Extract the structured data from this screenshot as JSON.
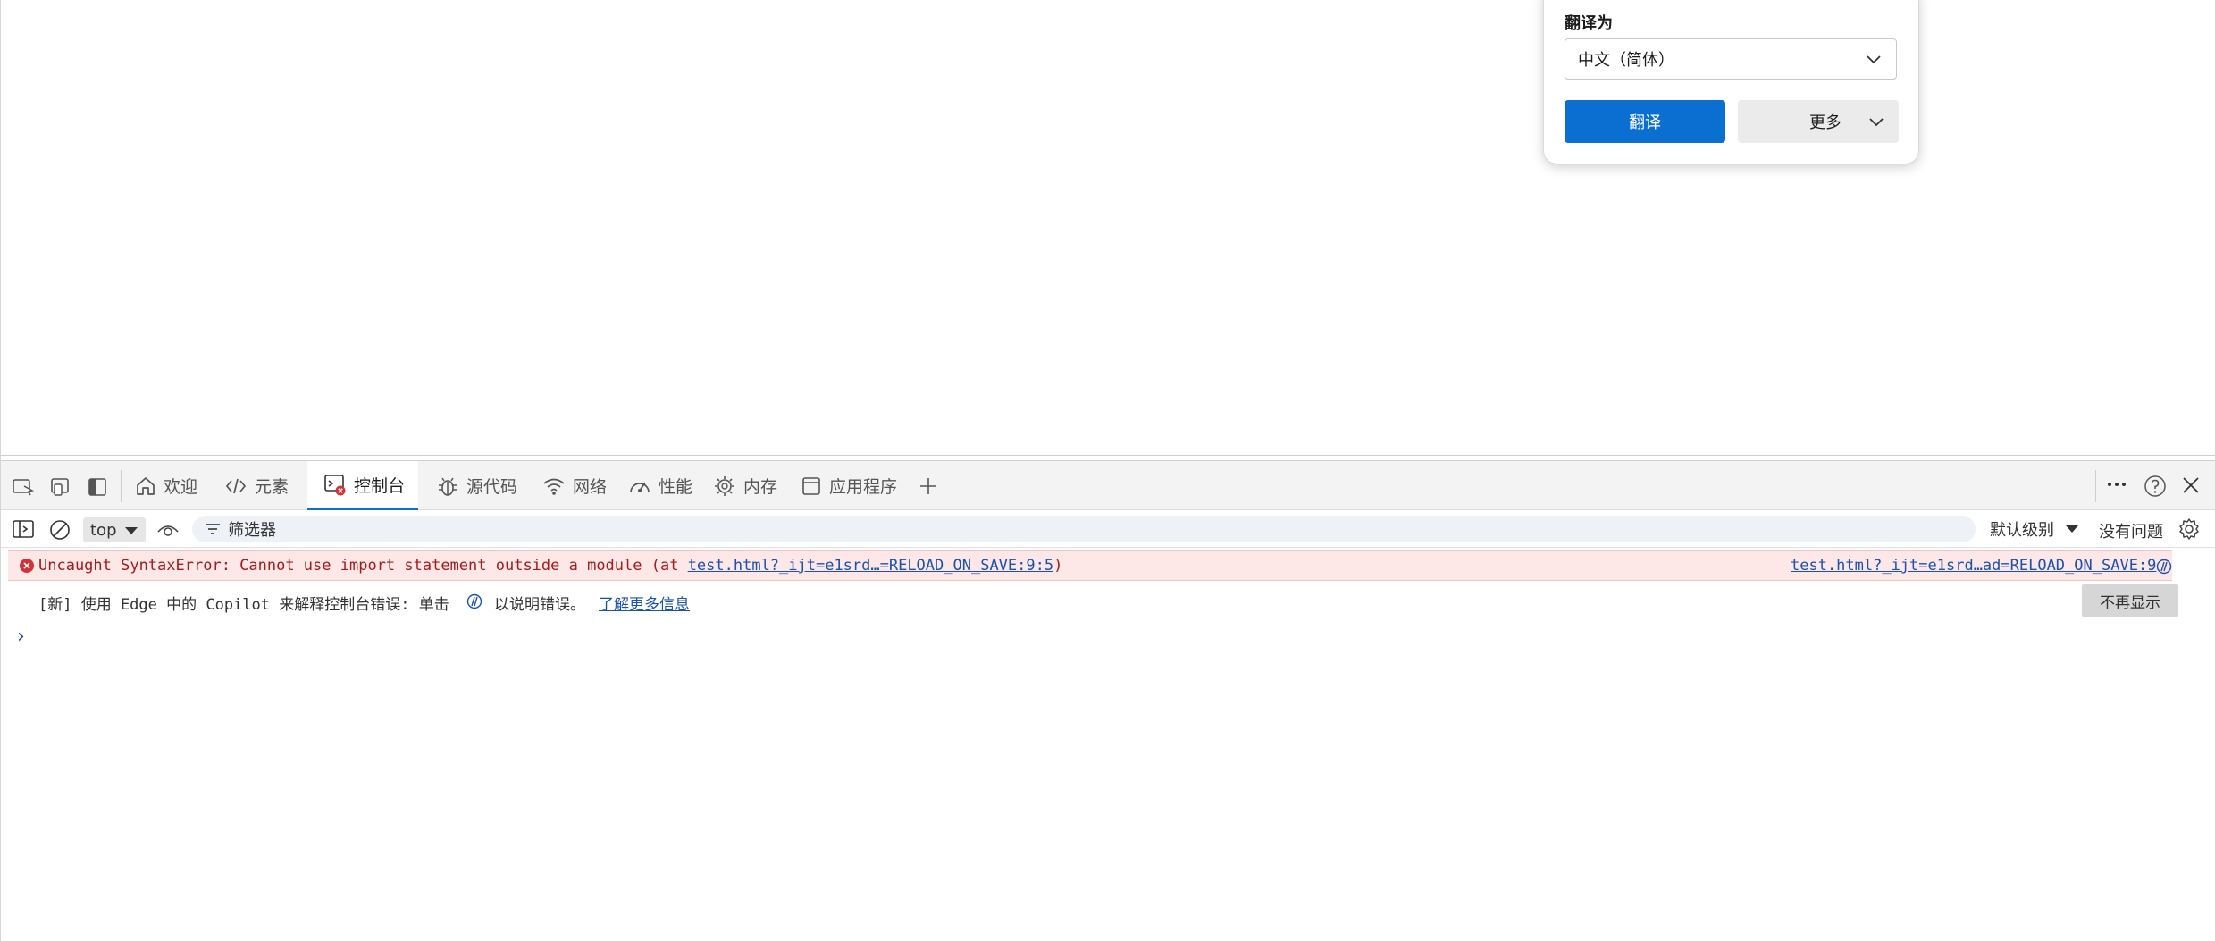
{
  "translate_popup": {
    "label": "翻译为",
    "language": "中文（简体）",
    "translate_button": "翻译",
    "more_button": "更多"
  },
  "devtools": {
    "tabs": [
      {
        "label": "欢迎",
        "icon": "home-icon"
      },
      {
        "label": "元素",
        "icon": "code-icon"
      },
      {
        "label": "控制台",
        "icon": "console-icon",
        "active": true
      },
      {
        "label": "源代码",
        "icon": "bug-icon"
      },
      {
        "label": "网络",
        "icon": "wifi-icon"
      },
      {
        "label": "性能",
        "icon": "gauge-icon"
      },
      {
        "label": "内存",
        "icon": "chip-icon"
      },
      {
        "label": "应用程序",
        "icon": "window-icon"
      }
    ],
    "toolbar": {
      "context": "top",
      "filter_placeholder": "筛选器",
      "level": "默认级别",
      "issues": "没有问题"
    },
    "error": {
      "prefix": "Uncaught SyntaxError: Cannot use import statement outside a module (at ",
      "link": "test.html?_ijt=e1srd…=RELOAD_ON_SAVE:9:5",
      "suffix": ")",
      "source": "test.html?_ijt=e1srd…ad=RELOAD_ON_SAVE:9"
    },
    "copilot_hint": {
      "text_before": "[新] 使用 Edge 中的 Copilot 来解释控制台错误: 单击",
      "text_after": "以说明错误。",
      "link": "了解更多信息",
      "dismiss": "不再显示"
    },
    "prompt": "›"
  },
  "colors": {
    "accent": "#0b6fd1",
    "error_bg": "#fde7e7",
    "error_text": "#a61b1b",
    "link": "#1a52b0"
  }
}
